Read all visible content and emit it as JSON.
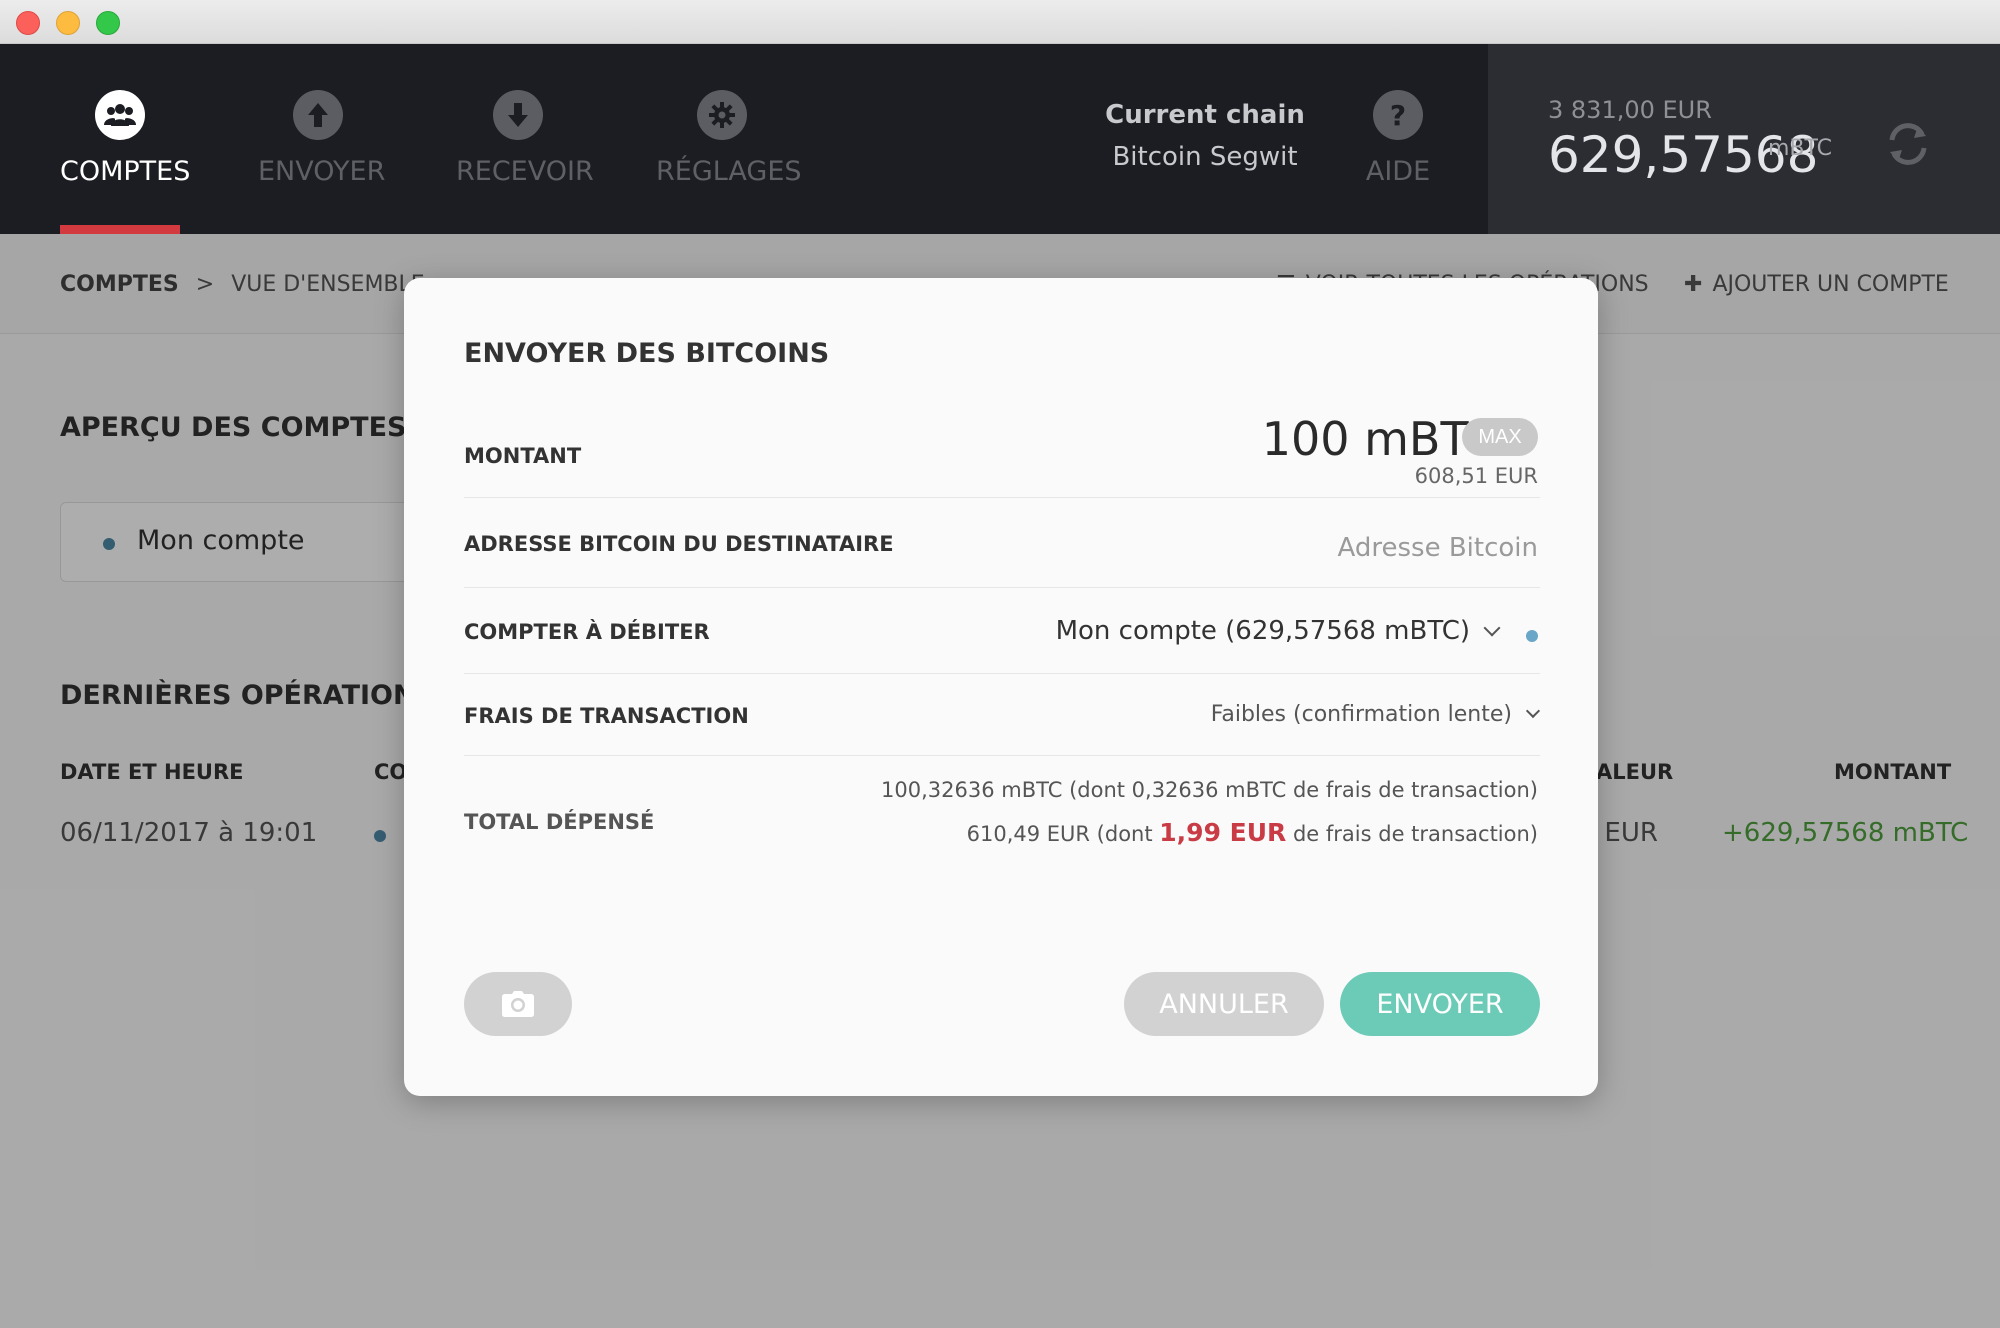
{
  "nav": {
    "items": [
      {
        "label": "COMPTES",
        "icon": "users-icon",
        "active": true
      },
      {
        "label": "ENVOYER",
        "icon": "upload-arrow-icon",
        "active": false
      },
      {
        "label": "RECEVOIR",
        "icon": "download-arrow-icon",
        "active": false
      },
      {
        "label": "RÉGLAGES",
        "icon": "gear-icon",
        "active": false
      }
    ],
    "chain_label": "Current chain",
    "chain_value": "Bitcoin Segwit",
    "help_label": "AIDE"
  },
  "balance": {
    "eur": "3 831,00 EUR",
    "main": "629,57568",
    "unit": "mBTC"
  },
  "subbar": {
    "crumb_root": "COMPTES",
    "crumb_sep": ">",
    "crumb_current": "VUE D'ENSEMBLE",
    "view_all": "VOIR TOUTES LES OPÉRATIONS",
    "add_account": "AJOUTER UN COMPTE"
  },
  "page": {
    "accounts_title": "APERÇU DES COMPTES",
    "account_name": "Mon compte",
    "ops_title": "DERNIÈRES OPÉRATIONS",
    "col_date": "DATE ET HEURE",
    "col_account": "CO",
    "col_value": "ALEUR",
    "col_amount": "MONTANT",
    "row_date": "06/11/2017 à 19:01",
    "row_value": ") EUR",
    "row_amount": "+629,57568 mBTC"
  },
  "modal": {
    "title": "ENVOYER DES BITCOINS",
    "amount_label": "MONTANT",
    "amount_value": "100  mBTC",
    "max_label": "MAX",
    "amount_eur": "608,51 EUR",
    "address_label": "ADRESSE BITCOIN DU DESTINATAIRE",
    "address_placeholder": "Adresse Bitcoin",
    "address_value": "",
    "debit_label": "COMPTER À DÉBITER",
    "debit_value": "Mon compte (629,57568 mBTC)",
    "fees_label": "FRAIS DE TRANSACTION",
    "fees_value": "Faibles (confirmation lente)",
    "total_label": "TOTAL DÉPENSÉ",
    "total_btc": "100,32636 mBTC (dont 0,32636 mBTC de frais de transaction)",
    "total_eur_prefix": "610,49 EUR (dont ",
    "total_eur_fee": "1,99 EUR",
    "total_eur_suffix": " de frais de transaction)",
    "cancel_label": "ANNULER",
    "send_label": "ENVOYER",
    "colors": {
      "accent": "#6ccbb7",
      "fee_red": "#c93b45",
      "nav_active": "#d33a3f"
    }
  }
}
